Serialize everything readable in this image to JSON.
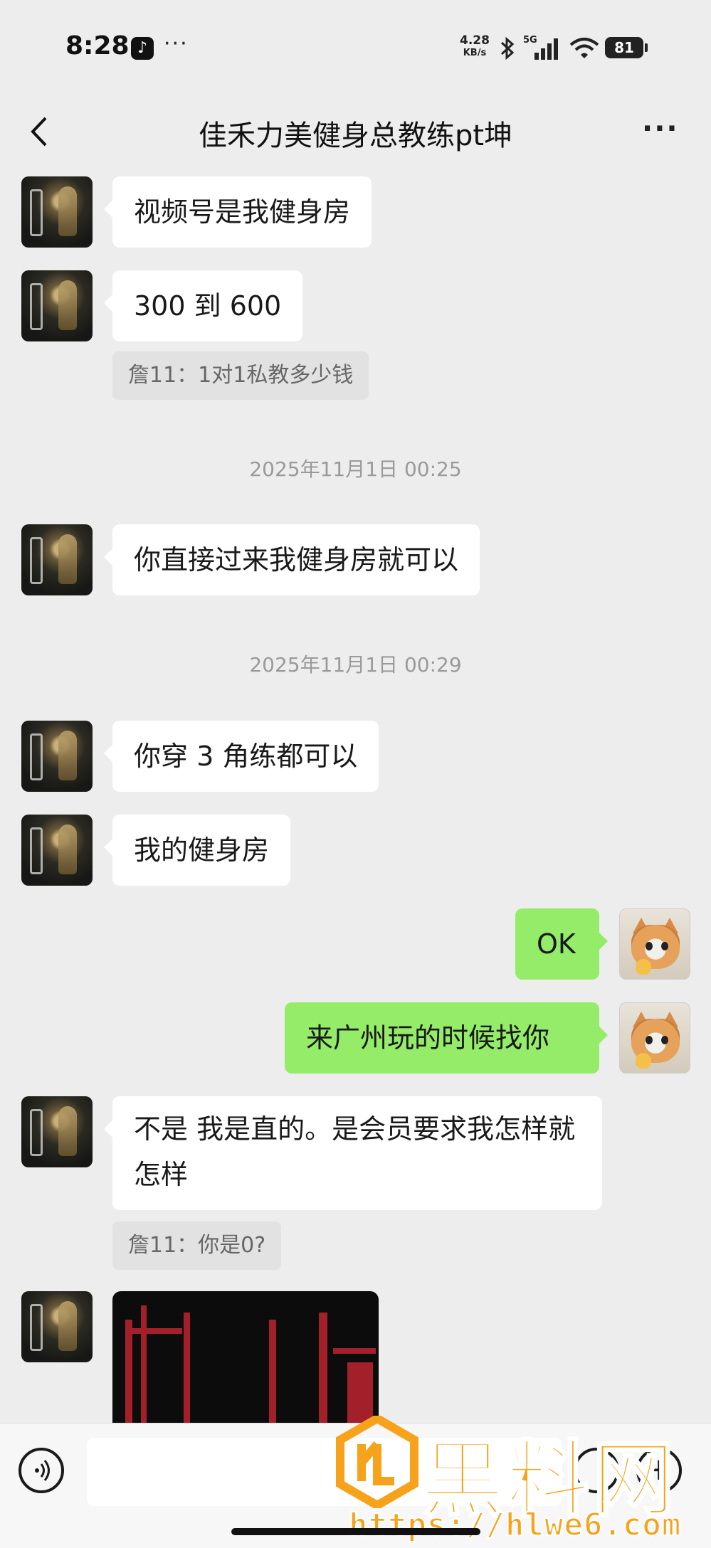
{
  "status_bar": {
    "time": "8:28",
    "dots": "···",
    "net_speed_value": "4.28",
    "net_speed_unit": "KB/s",
    "network": "5G",
    "battery": "81"
  },
  "header": {
    "title": "佳禾力美健身总教练pt坤",
    "more": "···"
  },
  "messages": [
    {
      "side": "left",
      "text": "视频号是我健身房"
    },
    {
      "side": "left",
      "text": "300 到 600"
    },
    {
      "side": "quote",
      "text": "詹11：1对1私教多少钱"
    },
    {
      "side": "time",
      "text": "2025年11月1日 00:25"
    },
    {
      "side": "left",
      "text": "你直接过来我健身房就可以"
    },
    {
      "side": "time",
      "text": "2025年11月1日 00:29"
    },
    {
      "side": "left",
      "text": "你穿 3 角练都可以"
    },
    {
      "side": "left",
      "text": "我的健身房"
    },
    {
      "side": "right",
      "text": "OK"
    },
    {
      "side": "right",
      "text": "来广州玩的时候找你"
    },
    {
      "side": "left",
      "text": "不是 我是直的。是会员要求我怎样就怎样"
    },
    {
      "side": "quote",
      "text": "詹11：你是0?"
    },
    {
      "side": "left",
      "text": "[image]"
    }
  ],
  "watermark": {
    "title": "黑料网",
    "url": "https://hlwe6.com"
  },
  "colors": {
    "background": "#ededed",
    "received_bubble": "#ffffff",
    "sent_bubble": "#95ec69",
    "watermark": "#f6a21a"
  },
  "icons": {
    "back": "chevron-left-icon",
    "more": "more-horizontal-icon",
    "voice": "voice-icon",
    "emoji": "emoji-icon",
    "plus": "plus-icon"
  }
}
